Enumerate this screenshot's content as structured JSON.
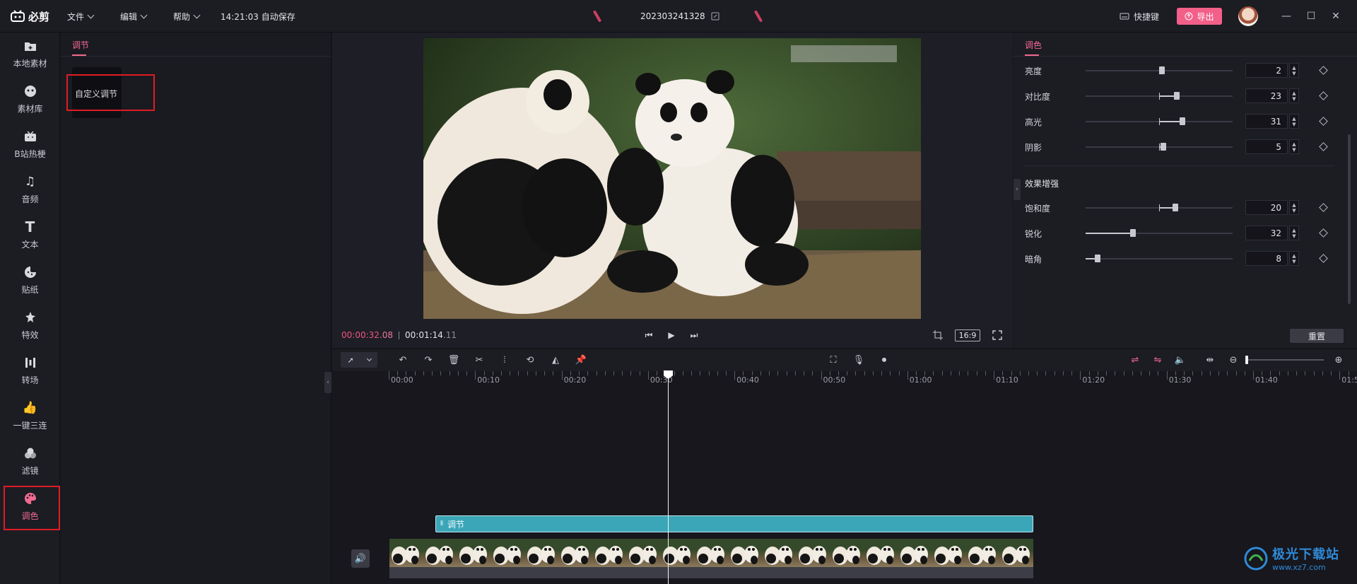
{
  "app": {
    "logo_text": "必剪",
    "autosave_time": "14:21:03 自动保存"
  },
  "menu": [
    {
      "label": "文件"
    },
    {
      "label": "编辑"
    },
    {
      "label": "帮助"
    }
  ],
  "project": {
    "name": "202303241328"
  },
  "header": {
    "shortcut_label": "快捷键",
    "export_label": "导出"
  },
  "sidebar": {
    "items": [
      {
        "label": "本地素材",
        "icon": "folder-icon"
      },
      {
        "label": "素材库",
        "icon": "material-library-icon"
      },
      {
        "label": "B站热梗",
        "icon": "bilibili-tv-icon"
      },
      {
        "label": "音频",
        "icon": "music-note-icon"
      },
      {
        "label": "文本",
        "icon": "text-t-icon"
      },
      {
        "label": "贴纸",
        "icon": "sticker-icon"
      },
      {
        "label": "特效",
        "icon": "effects-star-icon"
      },
      {
        "label": "转场",
        "icon": "transition-icon"
      },
      {
        "label": "一键三连",
        "icon": "thumbs-up-icon"
      },
      {
        "label": "滤镜",
        "icon": "filter-circles-icon"
      },
      {
        "label": "调色",
        "icon": "palette-icon",
        "active": true
      }
    ]
  },
  "left_panel": {
    "tab": "调节",
    "preset_label": "自定义调节"
  },
  "player": {
    "current_time_main": "00:00:32",
    "current_time_frames": ".08",
    "total_time_main": "00:01:14",
    "total_time_frames": ".11",
    "aspect_ratio": "16:9"
  },
  "right_panel": {
    "tab": "调色",
    "basic": [
      {
        "label": "亮度",
        "value": "2",
        "level": 0.52,
        "bidirectional": true
      },
      {
        "label": "对比度",
        "value": "23",
        "level": 0.62,
        "bidirectional": true
      },
      {
        "label": "高光",
        "value": "31",
        "level": 0.66,
        "bidirectional": true
      },
      {
        "label": "阴影",
        "value": "5",
        "level": 0.53,
        "bidirectional": true
      }
    ],
    "enhance_title": "效果增强",
    "enhance": [
      {
        "label": "饱和度",
        "value": "20",
        "level": 0.61,
        "bidirectional": true
      },
      {
        "label": "锐化",
        "value": "32",
        "level": 0.32,
        "bidirectional": false
      },
      {
        "label": "暗角",
        "value": "8",
        "level": 0.08,
        "bidirectional": false
      }
    ],
    "reset_label": "重置"
  },
  "timeline": {
    "ruler_labels": [
      "00:00",
      "00:10",
      "00:20",
      "00:30",
      "00:40",
      "00:50",
      "01:00",
      "01:10",
      "01:20",
      "01:30",
      "01:40",
      "01:5"
    ],
    "adjust_clip_label": "调节"
  },
  "watermark": {
    "text": "极光下载站",
    "url": "www.xz7.com"
  },
  "colors": {
    "accent": "#f06a90",
    "export": "#f25f89",
    "highlight_box": "#e01c24",
    "clip": "#3ba6b8"
  }
}
